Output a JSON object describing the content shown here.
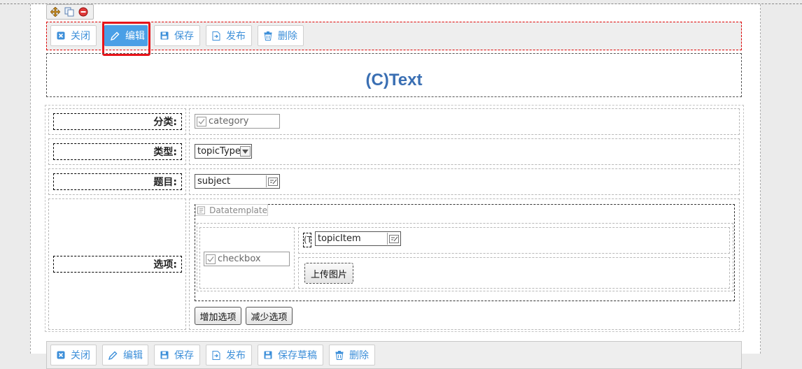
{
  "toolbar": {
    "close": "关闭",
    "edit": "编辑",
    "save": "保存",
    "publish": "发布",
    "delete": "删除"
  },
  "header": {
    "title": "(C)Text"
  },
  "form": {
    "category_label": "分类:",
    "category_field": "category",
    "type_label": "类型:",
    "type_field": "topicType",
    "subject_label": "题目:",
    "subject_field": "subject",
    "options_label": "选项:",
    "datatemplate": "Datatemplate",
    "checkbox_field": "checkbox",
    "prefix_char": "(T",
    "topicitem_field": "topicItem",
    "upload_button": "上传图片",
    "add_option_button": "增加选项",
    "remove_option_button": "减少选项"
  },
  "toolbar_bottom": {
    "close": "关闭",
    "edit": "编辑",
    "save": "保存",
    "publish": "发布",
    "save_draft": "保存草稿",
    "delete": "删除"
  },
  "colors": {
    "accent": "#4a9fe6",
    "link_text": "#3d8fd9",
    "title": "#3a6fb3",
    "highlight_frame": "#e8141a",
    "toolbar_frame": "#e00000"
  }
}
